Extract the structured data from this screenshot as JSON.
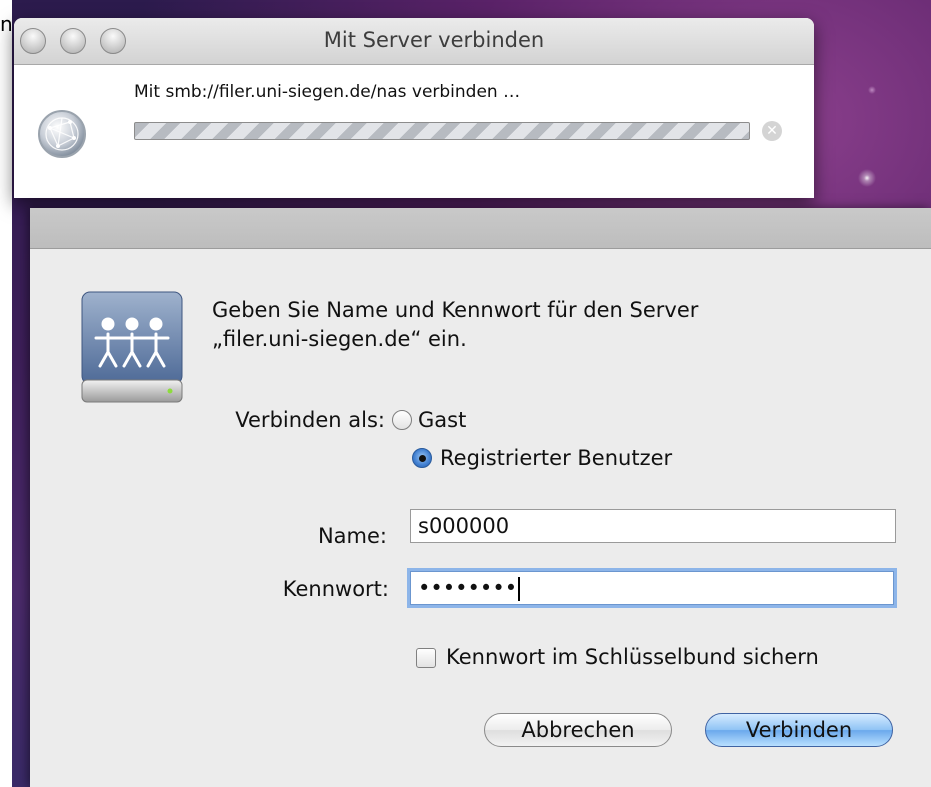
{
  "stray_char": "n",
  "connect_window": {
    "title": "Mit Server verbinden",
    "message": "Mit smb://filer.uni-siegen.de/nas verbinden …",
    "progress": 1.0
  },
  "login_sheet": {
    "prompt_line1": "Geben Sie Name und Kennwort für den Server",
    "prompt_line2": "„filer.uni-siegen.de“ ein.",
    "connect_as_label": "Verbinden als:",
    "options": [
      {
        "label": "Gast",
        "selected": false
      },
      {
        "label": "Registrierter Benutzer",
        "selected": true
      }
    ],
    "name_label": "Name:",
    "name_value": "s000000",
    "password_label": "Kennwort:",
    "password_value": "••••••••",
    "keychain_label": "Kennwort im Schlüsselbund sichern",
    "keychain_checked": false,
    "cancel_label": "Abbrechen",
    "connect_label": "Verbinden"
  },
  "colors": {
    "accent_blue": "#6aa8ec",
    "focus_ring": "#8db5e9"
  },
  "icons": [
    "globe-network-icon",
    "stop-icon",
    "server-drive-icon"
  ]
}
